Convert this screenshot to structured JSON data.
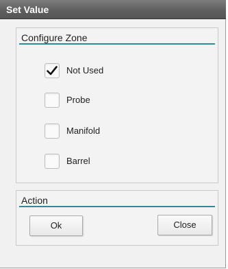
{
  "window": {
    "title": "Set Value"
  },
  "configure_zone": {
    "header": "Configure Zone",
    "options": [
      {
        "label": "Not Used",
        "checked": true
      },
      {
        "label": "Probe",
        "checked": false
      },
      {
        "label": "Manifold",
        "checked": false
      },
      {
        "label": "Barrel",
        "checked": false
      }
    ]
  },
  "action": {
    "header": "Action",
    "ok_label": "Ok",
    "close_label": "Close"
  },
  "colors": {
    "title_bar": "#5f5f5f",
    "header_rule": "#2e8a97",
    "background": "#f1f1f1"
  },
  "icons": {
    "checked": "checkmark-icon"
  }
}
